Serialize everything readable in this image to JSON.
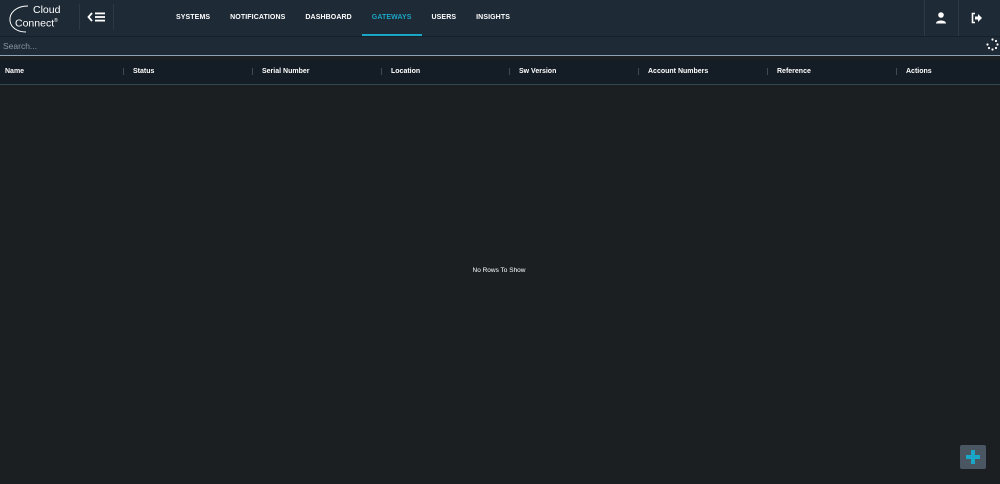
{
  "brand": {
    "line1": "Cloud",
    "line2": "Connect",
    "mark": "®"
  },
  "nav": {
    "items": [
      {
        "label": "SYSTEMS",
        "active": false
      },
      {
        "label": "NOTIFICATIONS",
        "active": false
      },
      {
        "label": "DASHBOARD",
        "active": false
      },
      {
        "label": "GATEWAYS",
        "active": true
      },
      {
        "label": "USERS",
        "active": false
      },
      {
        "label": "INSIGHTS",
        "active": false
      }
    ],
    "toggle_icon": "chevron-left-menu-icon",
    "user_icon": "user-icon",
    "logout_icon": "logout-icon"
  },
  "search": {
    "placeholder": "Search...",
    "value": "",
    "status_icon": "loading-spinner-icon"
  },
  "grid": {
    "columns": [
      "Name",
      "Status",
      "Serial Number",
      "Location",
      "Sw Version",
      "Account Numbers",
      "Reference",
      "Actions"
    ],
    "empty_message": "No Rows To Show"
  },
  "fab": {
    "icon": "plus-icon"
  },
  "colors": {
    "accent": "#1aa6c6",
    "topbar": "#1e2a36",
    "header": "#141c25",
    "body": "#1b1f22"
  }
}
